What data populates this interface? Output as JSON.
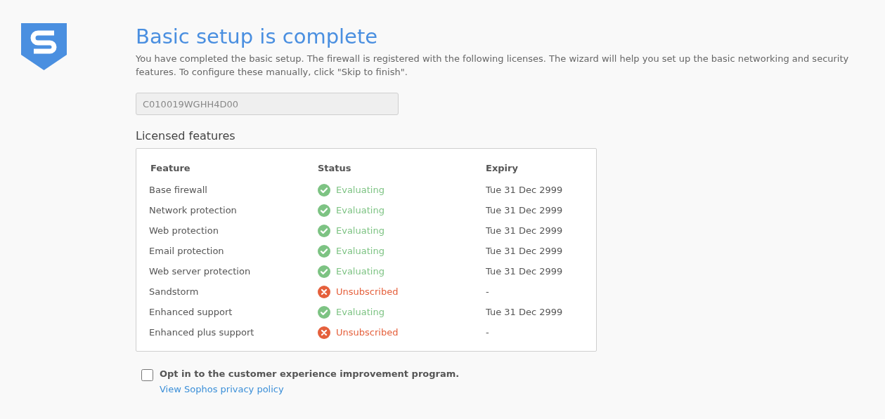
{
  "title": "Basic setup is complete",
  "intro": "You have completed the basic setup. The firewall is registered with the following licenses. The wizard will help you set up the basic networking and security features. To configure these manually, click \"Skip to finish\".",
  "serial_field": {
    "value": "C010019WGHH4D00",
    "disabled": true
  },
  "licensed_features": {
    "heading": "Licensed features",
    "columns": [
      "Feature",
      "Status",
      "Expiry"
    ],
    "rows": [
      {
        "feature": "Base firewall",
        "status": "Evaluating",
        "kind": "evaluating",
        "expiry": "Tue 31 Dec 2999"
      },
      {
        "feature": "Network protection",
        "status": "Evaluating",
        "kind": "evaluating",
        "expiry": "Tue 31 Dec 2999"
      },
      {
        "feature": "Web protection",
        "status": "Evaluating",
        "kind": "evaluating",
        "expiry": "Tue 31 Dec 2999"
      },
      {
        "feature": "Email protection",
        "status": "Evaluating",
        "kind": "evaluating",
        "expiry": "Tue 31 Dec 2999"
      },
      {
        "feature": "Web server protection",
        "status": "Evaluating",
        "kind": "evaluating",
        "expiry": "Tue 31 Dec 2999"
      },
      {
        "feature": "Sandstorm",
        "status": "Unsubscribed",
        "kind": "unsubscribed",
        "expiry": "-"
      },
      {
        "feature": "Enhanced support",
        "status": "Evaluating",
        "kind": "evaluating",
        "expiry": "Tue 31 Dec 2999"
      },
      {
        "feature": "Enhanced plus support",
        "status": "Unsubscribed",
        "kind": "unsubscribed",
        "expiry": "-"
      }
    ]
  },
  "opt_in": {
    "label": "Opt in to the customer experience improvement program.",
    "checked": false,
    "link": "View Sophos privacy policy"
  }
}
